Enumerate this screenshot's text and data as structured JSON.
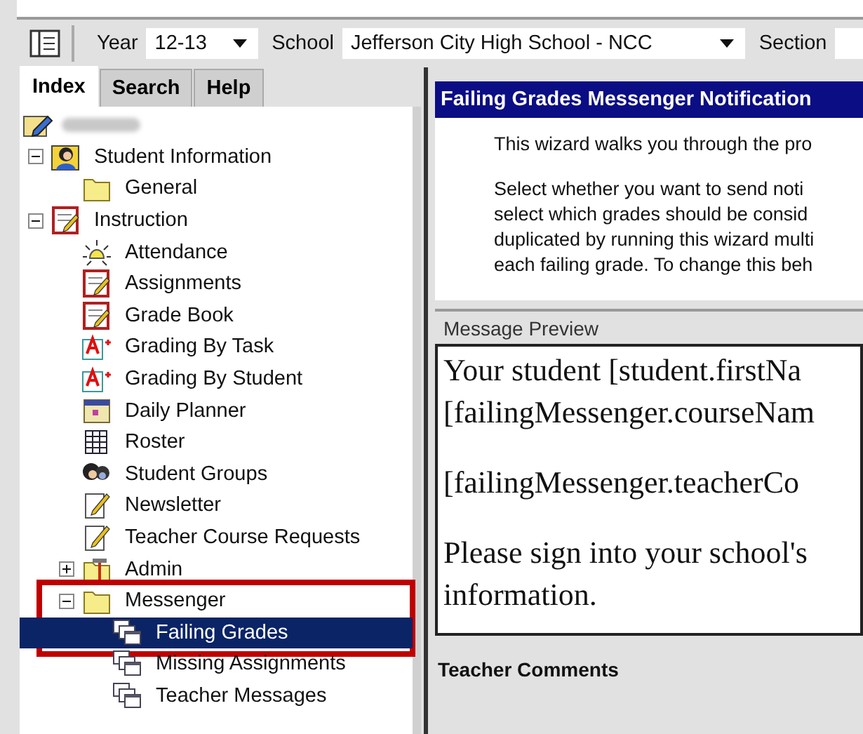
{
  "toolbar": {
    "fields": [
      {
        "label": "Year",
        "value": "12-13"
      },
      {
        "label": "School",
        "value": "Jefferson City High School - NCC"
      },
      {
        "label": "Section"
      }
    ]
  },
  "tabs": [
    {
      "label": "Index",
      "selected": true
    },
    {
      "label": "Search",
      "selected": false
    },
    {
      "label": "Help",
      "selected": false
    }
  ],
  "tree": {
    "kind": "student",
    "children": [
      {
        "label": "Student Information",
        "kind": "person",
        "expanded": true,
        "selected": false,
        "children": [
          {
            "label": "General",
            "kind": "folder",
            "selected": false
          }
        ]
      },
      {
        "label": "Instruction",
        "kind": "notebook",
        "expanded": true,
        "selected": false,
        "children": [
          {
            "label": "Attendance",
            "kind": "bell",
            "selected": false
          },
          {
            "label": "Assignments",
            "kind": "notebook",
            "selected": false
          },
          {
            "label": "Grade Book",
            "kind": "notebook",
            "selected": false
          },
          {
            "label": "Grading By Task",
            "kind": "grade",
            "selected": false
          },
          {
            "label": "Grading By Student",
            "kind": "grade",
            "selected": false
          },
          {
            "label": "Daily Planner",
            "kind": "calendar",
            "selected": false
          },
          {
            "label": "Roster",
            "kind": "grid",
            "selected": false
          },
          {
            "label": "Student Groups",
            "kind": "group",
            "selected": false
          },
          {
            "label": "Newsletter",
            "kind": "note",
            "selected": false
          },
          {
            "label": "Teacher Course Requests",
            "kind": "note",
            "selected": false
          },
          {
            "label": "Admin",
            "kind": "tools",
            "expanded": false,
            "selected": false
          },
          {
            "label": "Messenger",
            "kind": "folder",
            "expanded": true,
            "highlighted": true,
            "selected": false,
            "children": [
              {
                "label": "Failing Grades",
                "kind": "windows",
                "selected": true
              },
              {
                "label": "Missing Assignments",
                "kind": "windows",
                "selected": false
              },
              {
                "label": "Teacher Messages",
                "kind": "windows",
                "selected": false
              }
            ]
          }
        ]
      }
    ]
  },
  "panel": {
    "title": "Failing Grades Messenger Notification",
    "intro": [
      "This wizard walks you through the pro",
      "Select whether you want to send noti\nselect which grades should be consid\nduplicated by running this wizard multi\neach failing grade. To change this beh"
    ],
    "preview_label": "Message Preview",
    "preview": [
      "Your student [student.firstNa\n[failingMessenger.courseNam",
      "[failingMessenger.teacherCo",
      "Please sign into your school's\ninformation."
    ],
    "comments_label": "Teacher Comments"
  }
}
